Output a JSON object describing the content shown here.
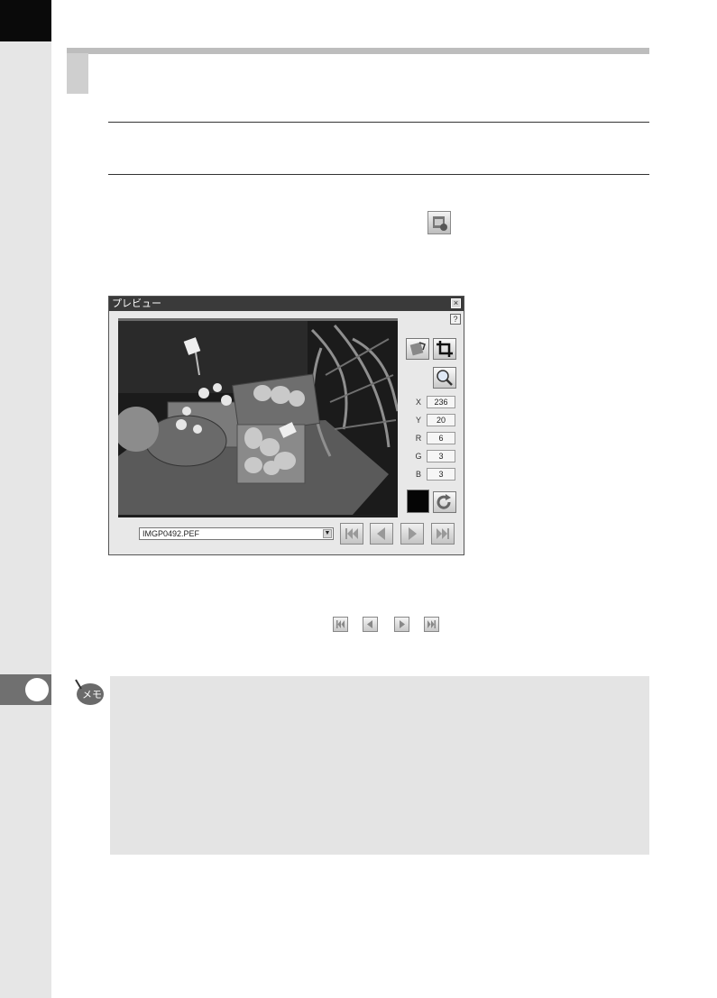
{
  "preview_window": {
    "title": "プレビュー",
    "close_glyph": "×",
    "help_glyph": "?",
    "readouts": [
      {
        "label": "X",
        "value": "236"
      },
      {
        "label": "Y",
        "value": "20"
      },
      {
        "label": "R",
        "value": "6"
      },
      {
        "label": "G",
        "value": "3"
      },
      {
        "label": "B",
        "value": "3"
      }
    ],
    "swatch_color": "#050505",
    "file_select": {
      "value": "IMGP0492.PEF"
    },
    "nav_icons": [
      "first-icon",
      "previous-icon",
      "next-icon",
      "last-icon"
    ]
  },
  "memo": {
    "icon_label": "メモ"
  },
  "colors": {
    "left_tab": "#e6e6e6",
    "chapter_marker": "#707070",
    "memo_background": "#e4e4e4"
  }
}
